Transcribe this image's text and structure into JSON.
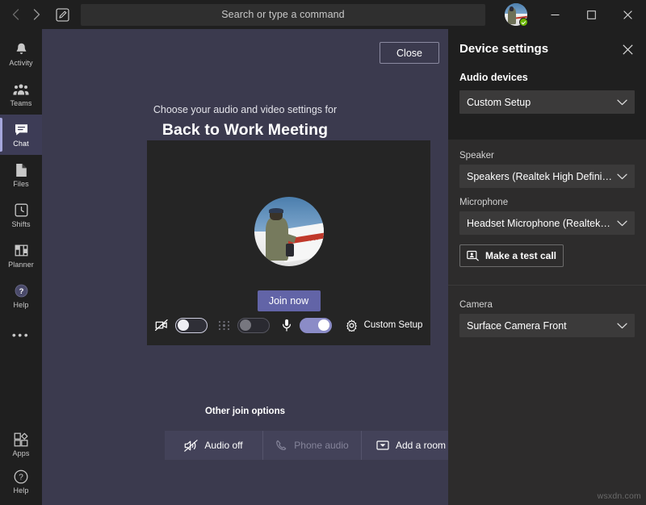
{
  "titlebar": {
    "back_icon": "chevron-left-icon",
    "forward_icon": "chevron-right-icon",
    "compose_icon": "compose-new-chat-icon",
    "search_placeholder": "Search or type a command",
    "avatar_status": "available",
    "minimize_label": "Minimize",
    "maximize_label": "Maximize",
    "close_label": "Close"
  },
  "rail": {
    "items": [
      {
        "label": "Activity",
        "icon": "bell-icon",
        "active": false
      },
      {
        "label": "Teams",
        "icon": "people-icon",
        "active": false
      },
      {
        "label": "Chat",
        "icon": "chat-bubble-icon",
        "active": true
      },
      {
        "label": "Files",
        "icon": "file-icon",
        "active": false
      },
      {
        "label": "Shifts",
        "icon": "clock-icon",
        "active": false
      },
      {
        "label": "Planner",
        "icon": "planner-grid-icon",
        "active": false
      },
      {
        "label": "Help",
        "icon": "help-circle-filled-icon",
        "active": false
      }
    ],
    "more_label": "•••",
    "bottom_items": [
      {
        "label": "Apps",
        "icon": "apps-icon"
      },
      {
        "label": "Help",
        "icon": "help-circle-icon"
      }
    ]
  },
  "prejoin": {
    "close_label": "Close",
    "subtitle": "Choose your audio and video settings for",
    "meeting_title": "Back to Work Meeting",
    "join_label": "Join now",
    "camera": {
      "icon": "camera-off-icon",
      "state": "off",
      "label": "Camera"
    },
    "background": {
      "icon": "background-blur-icon",
      "state": "off-disabled",
      "label": "Background filters"
    },
    "microphone": {
      "icon": "microphone-icon",
      "state": "on",
      "label": "Microphone"
    },
    "device_link": {
      "icon": "gear-icon",
      "label": "Custom Setup"
    },
    "other_title": "Other join options",
    "other_options": [
      {
        "label": "Audio off",
        "icon": "speaker-off-icon",
        "disabled": false
      },
      {
        "label": "Phone audio",
        "icon": "phone-icon",
        "disabled": true
      },
      {
        "label": "Add a room",
        "icon": "add-room-icon",
        "disabled": false
      }
    ]
  },
  "device_settings": {
    "title": "Device settings",
    "close_icon": "close-icon",
    "audio_devices": {
      "group_label": "Audio devices",
      "value": "Custom Setup"
    },
    "speaker": {
      "label": "Speaker",
      "value": "Speakers (Realtek High Definition Au..."
    },
    "microphone": {
      "label": "Microphone",
      "value": "Headset Microphone (Realtek High D..."
    },
    "test_call": {
      "label": "Make a test call",
      "icon": "test-call-icon"
    },
    "camera": {
      "label": "Camera",
      "value": "Surface Camera Front"
    }
  },
  "watermark": "wsxdn.com",
  "colors": {
    "accent": "#6264a7",
    "stage_bg": "#3b3a4e",
    "chrome_bg": "#1f1f1f",
    "panel_bg": "#2d2c2c",
    "status_available": "#6bb700"
  }
}
